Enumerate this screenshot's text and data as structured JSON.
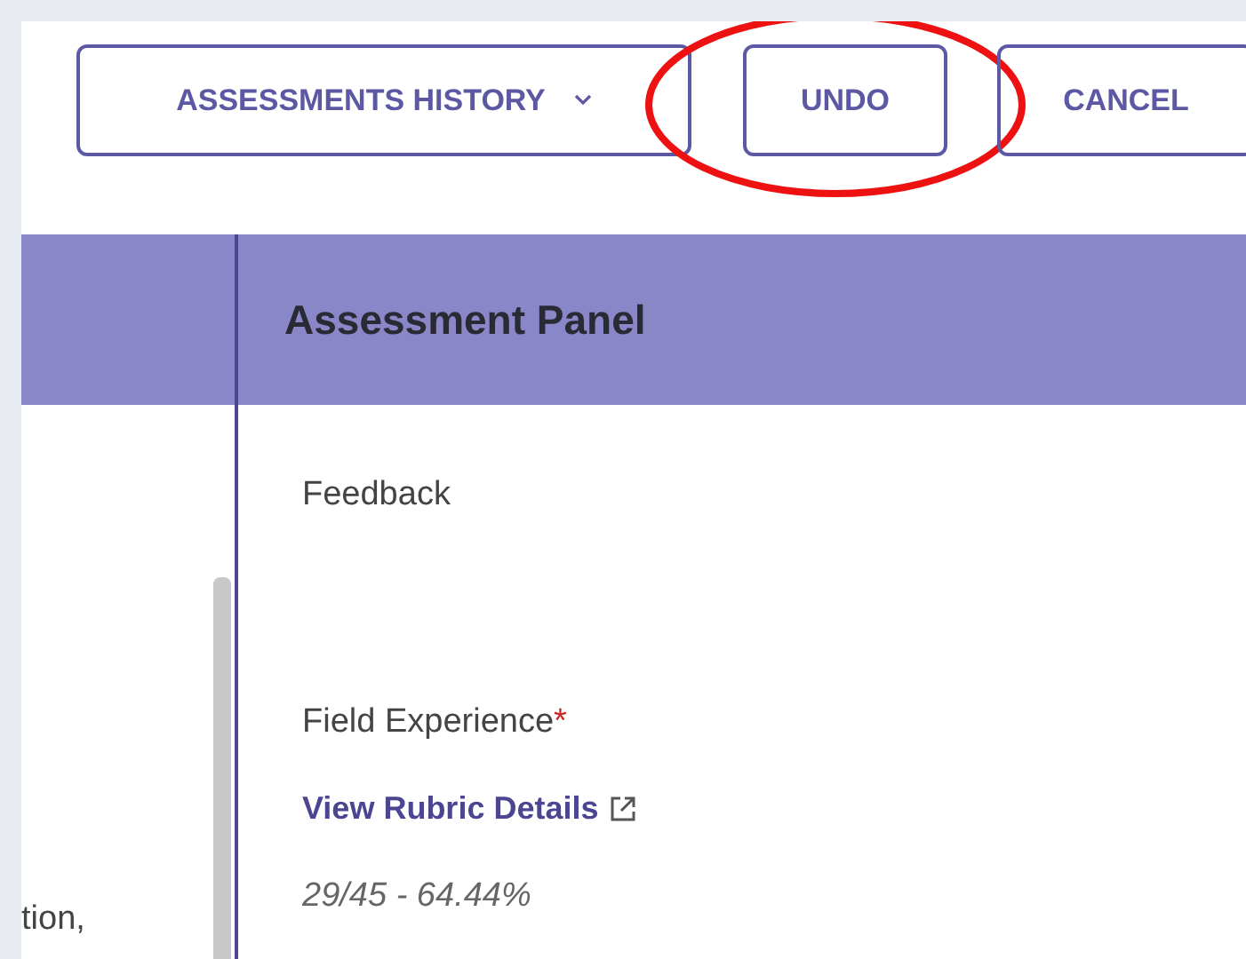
{
  "toolbar": {
    "buttons": [
      {
        "label": "ASSESSMENTS HISTORY",
        "kind": "dropdown"
      },
      {
        "label": "UNDO",
        "kind": "plain",
        "highlighted": true
      },
      {
        "label": "CANCEL",
        "kind": "plain"
      }
    ]
  },
  "left_pane": {
    "text": "tion,"
  },
  "panel": {
    "title": "Assessment Panel",
    "fields": [
      {
        "label": "Feedback"
      },
      {
        "label": "Field Experience",
        "required": true,
        "required_mark": "*",
        "link": "View Rubric Details",
        "score": "29/45 - 64.44%"
      }
    ]
  }
}
